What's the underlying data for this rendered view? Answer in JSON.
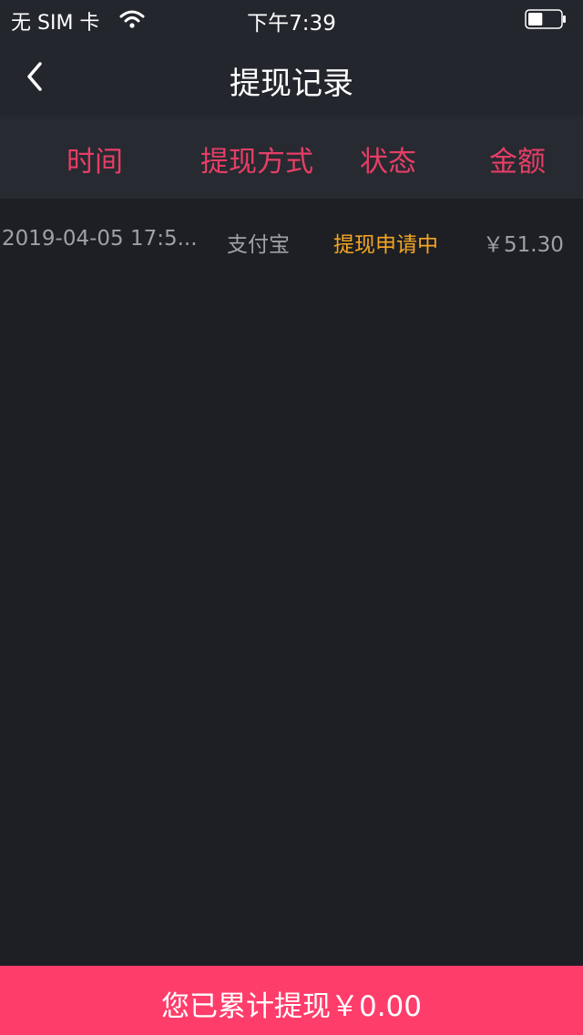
{
  "status_bar": {
    "carrier": "无 SIM 卡",
    "time": "下午7:39",
    "battery_level": 0.45,
    "wifi_icon": "wifi-icon",
    "battery_icon": "battery-icon"
  },
  "nav": {
    "title": "提现记录",
    "back_icon": "chevron-left-icon"
  },
  "table": {
    "headers": [
      "时间",
      "提现方式",
      "状态",
      "金额"
    ],
    "rows": [
      {
        "time": "2019-04-05 17:5...",
        "method": "支付宝",
        "status": "提现申请中",
        "amount": "￥51.30"
      }
    ]
  },
  "footer": {
    "total_text": "您已累计提现￥0.00"
  },
  "colors": {
    "background": "#1d1f24",
    "bar": "#23262d",
    "header_bg": "#272a31",
    "header_text": "#e63e66",
    "status_pending": "#f5a623",
    "footer_bg": "#ff3d6b"
  }
}
